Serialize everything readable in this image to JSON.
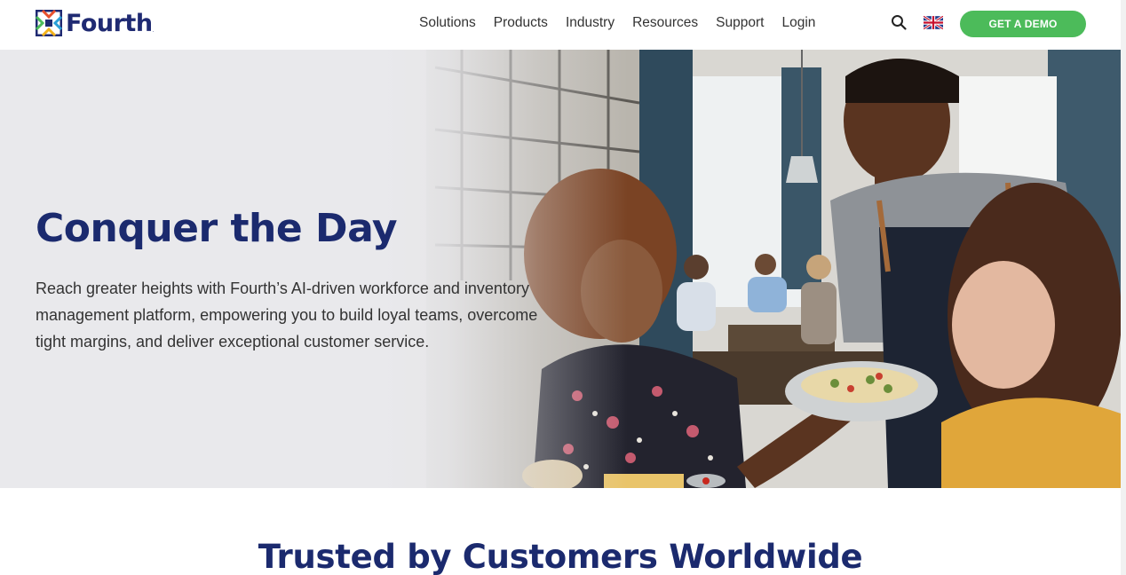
{
  "header": {
    "logo_text": "Fourth",
    "logo_reg": ".",
    "nav": [
      "Solutions",
      "Products",
      "Industry",
      "Resources",
      "Support",
      "Login"
    ],
    "search_icon": "search-icon",
    "flag_icon": "uk-flag-icon",
    "demo_label": "GET A DEMO"
  },
  "hero": {
    "title": "Conquer the Day",
    "text": "Reach greater heights with Fourth’s AI-driven workforce and inventory management platform, empowering you to build loyal teams, overcome tight margins, and deliver exceptional customer service.",
    "image": "restaurant-staff-serving-customers-photo"
  },
  "trusted": {
    "title": "Trusted by Customers Worldwide"
  },
  "colors": {
    "brand_navy": "#1b2a6e",
    "cta_green": "#4cbb5a",
    "hero_bg": "#e9e9ec"
  }
}
